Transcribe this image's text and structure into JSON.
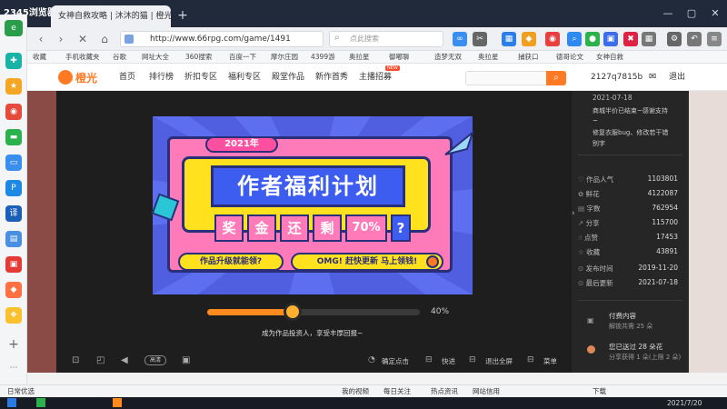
{
  "browser": {
    "logo_text": "2345浏览器",
    "tab_title": "女神自救攻略 | 沐沐的猫 | 橙光",
    "new_tab": "+",
    "url": "http://www.66rpg.com/game/1491",
    "search_placeholder": "点此搜索",
    "win_min": "—",
    "win_max": "▢",
    "win_close": "✕"
  },
  "bookmarks": [
    "收藏",
    "手机收藏夹",
    "谷歌",
    "网址大全",
    "360搜索",
    "百度一下",
    "摩尔庄园",
    "4399游",
    "奥拉星",
    "御嘟聊",
    "造梦无双",
    "奥拉星",
    "捕获口",
    "德哥论文",
    "女神自救"
  ],
  "site": {
    "brand": "橙光",
    "nav": [
      "首页",
      "排行榜",
      "折扣专区",
      "福利专区",
      "殿堂作品",
      "新作首秀",
      "主播招募"
    ],
    "nav_badge": "NEW",
    "user": "2127q7815b",
    "logout": "退出"
  },
  "sidebar_panel": {
    "date": "2021-07-18",
    "update_lines": [
      "商城半价已结束~感谢支持",
      "~",
      "修复衣服bug、修改若干错",
      "别字"
    ],
    "stats": [
      {
        "label": "作品人气",
        "value": "1103801"
      },
      {
        "label": "鲜花",
        "value": "4122087"
      },
      {
        "label": "字数",
        "value": "762954"
      },
      {
        "label": "分享",
        "value": "115700"
      },
      {
        "label": "点赞",
        "value": "17453"
      },
      {
        "label": "收藏",
        "value": "43891"
      },
      {
        "label": "发布时间",
        "value": "2019-11-20"
      },
      {
        "label": "最后更新",
        "value": "2021-07-18"
      }
    ],
    "paid": {
      "title": "付费内容",
      "sub": "解锁共需 25 朵"
    },
    "flowers": {
      "title": "您已送过 28 朵花",
      "sub": "分享获得 1 朵(上限 2 朵)"
    }
  },
  "poster": {
    "year": "2021年",
    "headline": "作者福利计划",
    "chars": [
      "奖",
      "金",
      "还",
      "剩",
      "70%",
      "?"
    ],
    "left_pill": "作品升级就能领?",
    "right_pill": "OMG! 赶快更新 马上领钱!"
  },
  "player": {
    "progress_percent": 40,
    "progress_label": "40%",
    "caption": "成为作品投资人，享受丰厚回报~",
    "quality": "高清",
    "controls": [
      "确定点击",
      "快进",
      "退出全屏",
      "菜单"
    ]
  },
  "statusbar": {
    "left": "日常优选",
    "items": [
      "我的视频",
      "每日关注",
      "热点资讯",
      "网站信用"
    ],
    "download": "下载",
    "date": "2021/7/20"
  },
  "colors": {
    "accent": "#ff7a22",
    "titlebar": "#202a3a",
    "poster_bg": "#4f5fe0",
    "poster_frame": "#ff7ab8",
    "poster_yellow": "#ffe11e"
  }
}
